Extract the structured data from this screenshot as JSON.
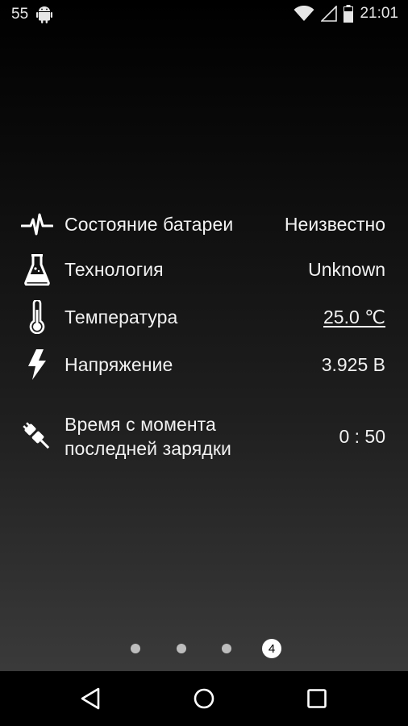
{
  "status_bar": {
    "notification_count": "55",
    "time": "21:01",
    "icons": [
      "android-icon",
      "wifi-icon",
      "signal-icon",
      "battery-icon"
    ]
  },
  "battery_info": [
    {
      "icon": "pulse-icon",
      "label": "Состояние батареи",
      "value": "Неизвестно"
    },
    {
      "icon": "flask-icon",
      "label": "Технология",
      "value": "Unknown"
    },
    {
      "icon": "thermometer-icon",
      "label": "Температура",
      "value": "25.0 ℃"
    },
    {
      "icon": "lightning-icon",
      "label": "Напряжение",
      "value": "3.925 В"
    },
    {
      "icon": "plug-icon",
      "label_line1": "Время с момента",
      "label_line2": "последней зарядки",
      "value": "0 : 50"
    }
  ],
  "pager": {
    "current_page": "4",
    "total_pages": 4
  },
  "nav_bar": {
    "icons": [
      "back-icon",
      "home-icon",
      "recents-icon"
    ]
  },
  "colors": {
    "text": "#f2f2f2",
    "dot_inactive": "#bdbdbd",
    "nav_background": "#000000"
  }
}
